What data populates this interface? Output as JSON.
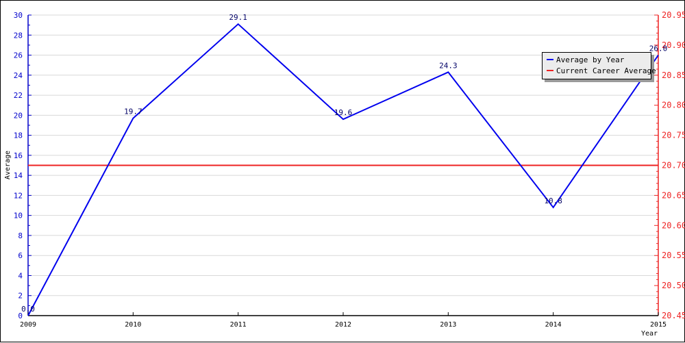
{
  "chart_data": {
    "type": "line",
    "title": "",
    "xlabel": "Year",
    "ylabel": "Average",
    "x": [
      "2009",
      "2010",
      "2011",
      "2012",
      "2013",
      "2014",
      "2015"
    ],
    "series": [
      {
        "name": "Average by Year",
        "color": "#0000ee",
        "axis": "left",
        "values": [
          0.0,
          19.7,
          29.1,
          19.6,
          24.3,
          10.8,
          26.0
        ],
        "labels": [
          "0.0",
          "19.7",
          "29.1",
          "19.6",
          "24.3",
          "10.8",
          "26.0"
        ]
      },
      {
        "name": "Current Career Average",
        "color": "#ee2222",
        "axis": "right",
        "value": 20.7
      }
    ],
    "ylim": [
      0,
      30
    ],
    "yticks": [
      0,
      2,
      4,
      6,
      8,
      10,
      12,
      14,
      16,
      18,
      20,
      22,
      24,
      26,
      28,
      30
    ],
    "y2lim": [
      20.45,
      20.95
    ],
    "y2ticks": [
      "20.45",
      "20.50",
      "20.55",
      "20.60",
      "20.65",
      "20.70",
      "20.75",
      "20.80",
      "20.85",
      "20.90",
      "20.95"
    ],
    "grid": true,
    "legend": "top-right",
    "axis_colors": {
      "left": "#0000cc",
      "right": "#ee2222",
      "x": "#000000"
    }
  }
}
